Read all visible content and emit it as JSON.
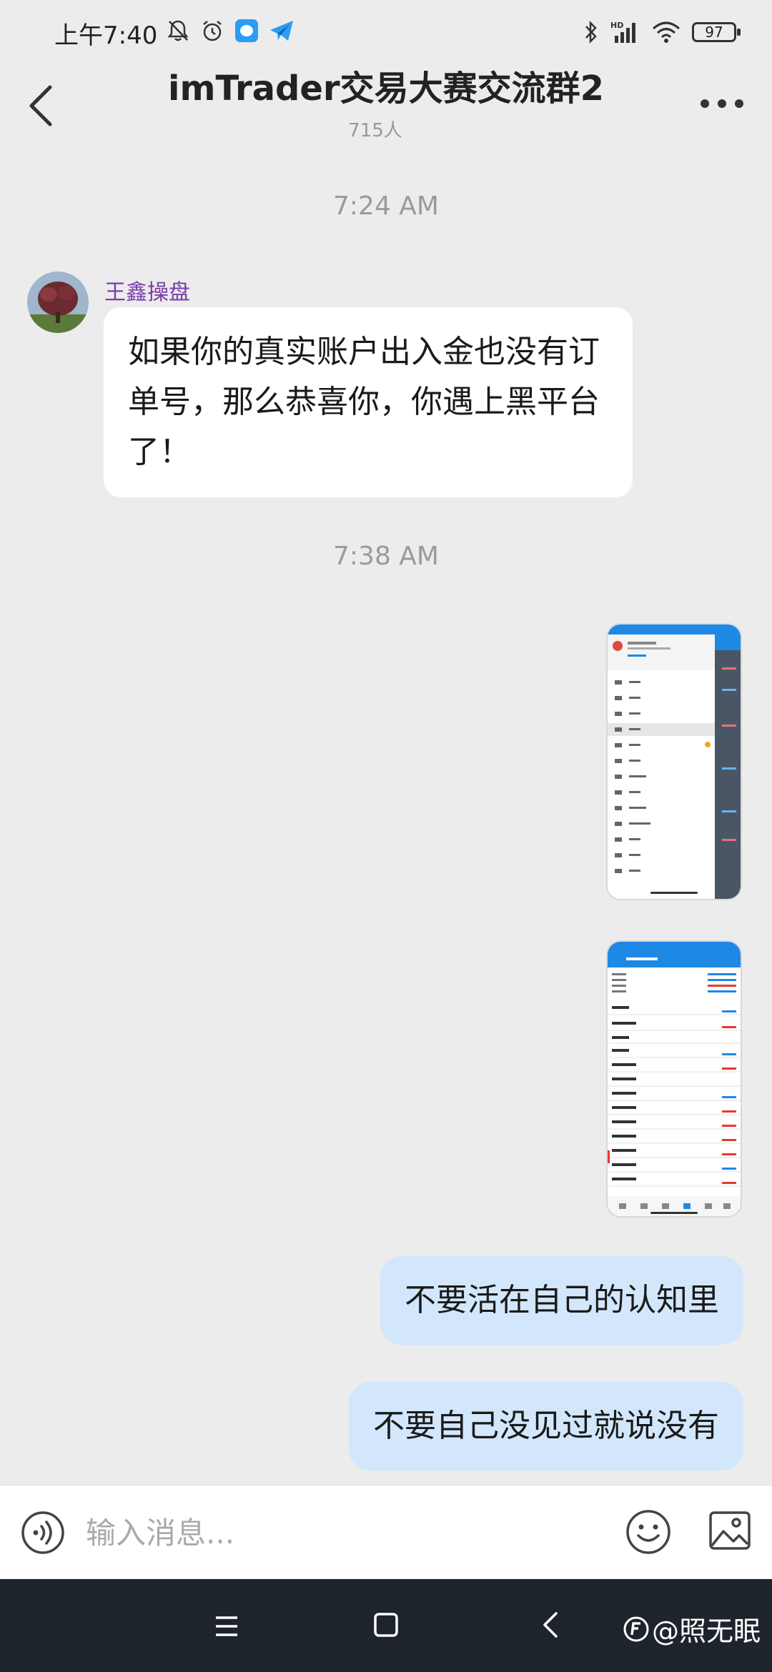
{
  "status_bar": {
    "time": "上午7:40",
    "left_icons": [
      "bell-off-icon",
      "alarm-icon",
      "chat-app-icon",
      "telegram-icon"
    ],
    "right_icons": [
      "bluetooth-icon",
      "signal-hd-icon",
      "wifi-icon"
    ],
    "battery_level": "97"
  },
  "header": {
    "title": "imTrader交易大赛交流群2",
    "member_count": "715人"
  },
  "messages": [
    {
      "type": "time",
      "text": "7:24 AM"
    },
    {
      "type": "incoming",
      "sender": "王鑫操盘",
      "text": "如果你的真实账户出入金也没有订单号，那么恭喜你，你遇上黑平台了！"
    },
    {
      "type": "time",
      "text": "7:38 AM"
    },
    {
      "type": "outgoing_image",
      "description": "app-menu-screenshot"
    },
    {
      "type": "outgoing_image",
      "description": "trade-history-screenshot"
    },
    {
      "type": "outgoing",
      "text": "不要活在自己的认知里"
    },
    {
      "type": "outgoing",
      "text": "不要自己没见过就说没有"
    }
  ],
  "input": {
    "placeholder": "输入消息..."
  },
  "watermark": {
    "text": "@照无眠"
  },
  "colors": {
    "background": "#ececec",
    "outgoing_bubble": "#d2e7fb",
    "incoming_bubble": "#ffffff",
    "sender_name": "#7a3ea8",
    "nav_bar": "#1e242c",
    "thumbnail_accent": "#1e88e5"
  }
}
